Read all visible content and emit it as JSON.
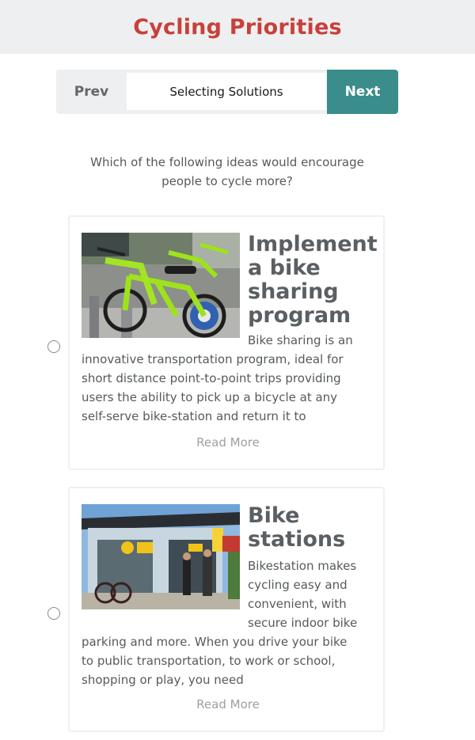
{
  "header": {
    "title": "Cycling Priorities"
  },
  "stepper": {
    "prev_label": "Prev",
    "current_label": "Selecting Solutions",
    "next_label": "Next"
  },
  "question": "Which of the following ideas would encourage people to cycle more?",
  "options": [
    {
      "title": "Implement a bike sharing program",
      "text_side": [
        "Bike sharing is an"
      ],
      "text_full": [
        "innovative transportation program, ideal for",
        "short distance point-to-point trips providing",
        "users the ability to pick up a bicycle at any",
        "self-serve bike-station and return it to"
      ],
      "read_more": "Read More"
    },
    {
      "title": "Bike stations",
      "text_side": [
        "Bikestation makes",
        "cycling easy and",
        "convenient, with",
        "secure indoor bike"
      ],
      "text_full": [
        "parking and more. When you drive your bike",
        "to public transportation, to work or school,",
        "shopping or play, you need"
      ],
      "read_more": "Read More"
    }
  ],
  "colors": {
    "title_red": "#c8403b",
    "next_teal": "#3a8d8a",
    "header_bg": "#eeeff0"
  }
}
